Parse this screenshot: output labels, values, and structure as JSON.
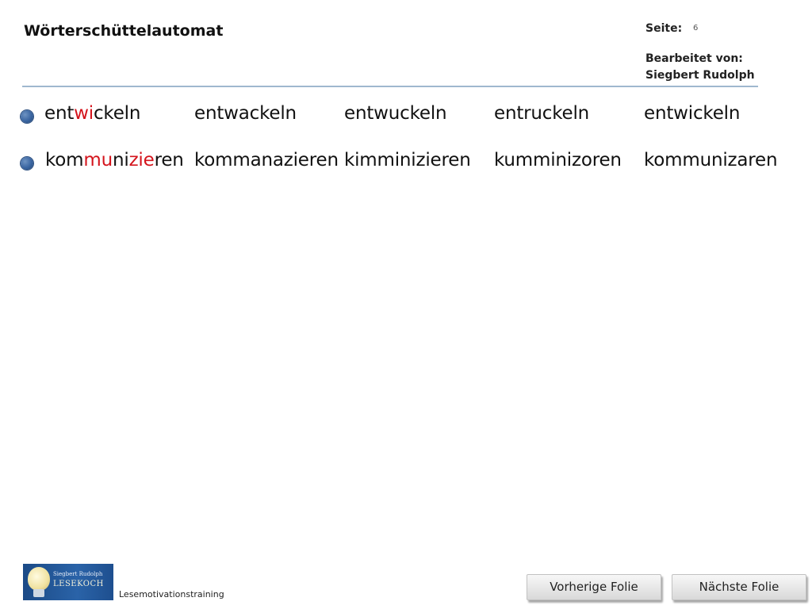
{
  "header": {
    "title": "Wörterschüttelautomat",
    "seite_label": "Seite:",
    "seite_value": "6",
    "bearbeitet_label": "Bearbeitet  von:",
    "bearbeitet_name": "Siegbert  Rudolph"
  },
  "rows": [
    {
      "word1": {
        "part1": "ent",
        "part2": "wi",
        "part3": "ckeln"
      },
      "word2": "entwackeln",
      "word3": "entwuckeln",
      "word4": "entruckeln",
      "word5": "entwickeln"
    },
    {
      "word1": {
        "part1": "kom",
        "part2": "mu",
        "part3": "ni",
        "part4": "zie",
        "part5": "ren"
      },
      "word2": "kommanazieren",
      "word3": "kimminizieren",
      "word4": "kumminizoren",
      "word5": "kommunizaren"
    }
  ],
  "footer": {
    "logo_name": "Siegbert Rudolph",
    "logo_word": "LESEKOCH",
    "text": "Lesemotivationstraining",
    "prev_label": "Vorherige Folie",
    "next_label": "Nächste Folie"
  },
  "colors": {
    "highlight": "#d4141c",
    "bullet": "#3a65a1",
    "header_line": "#9fb8cf"
  }
}
